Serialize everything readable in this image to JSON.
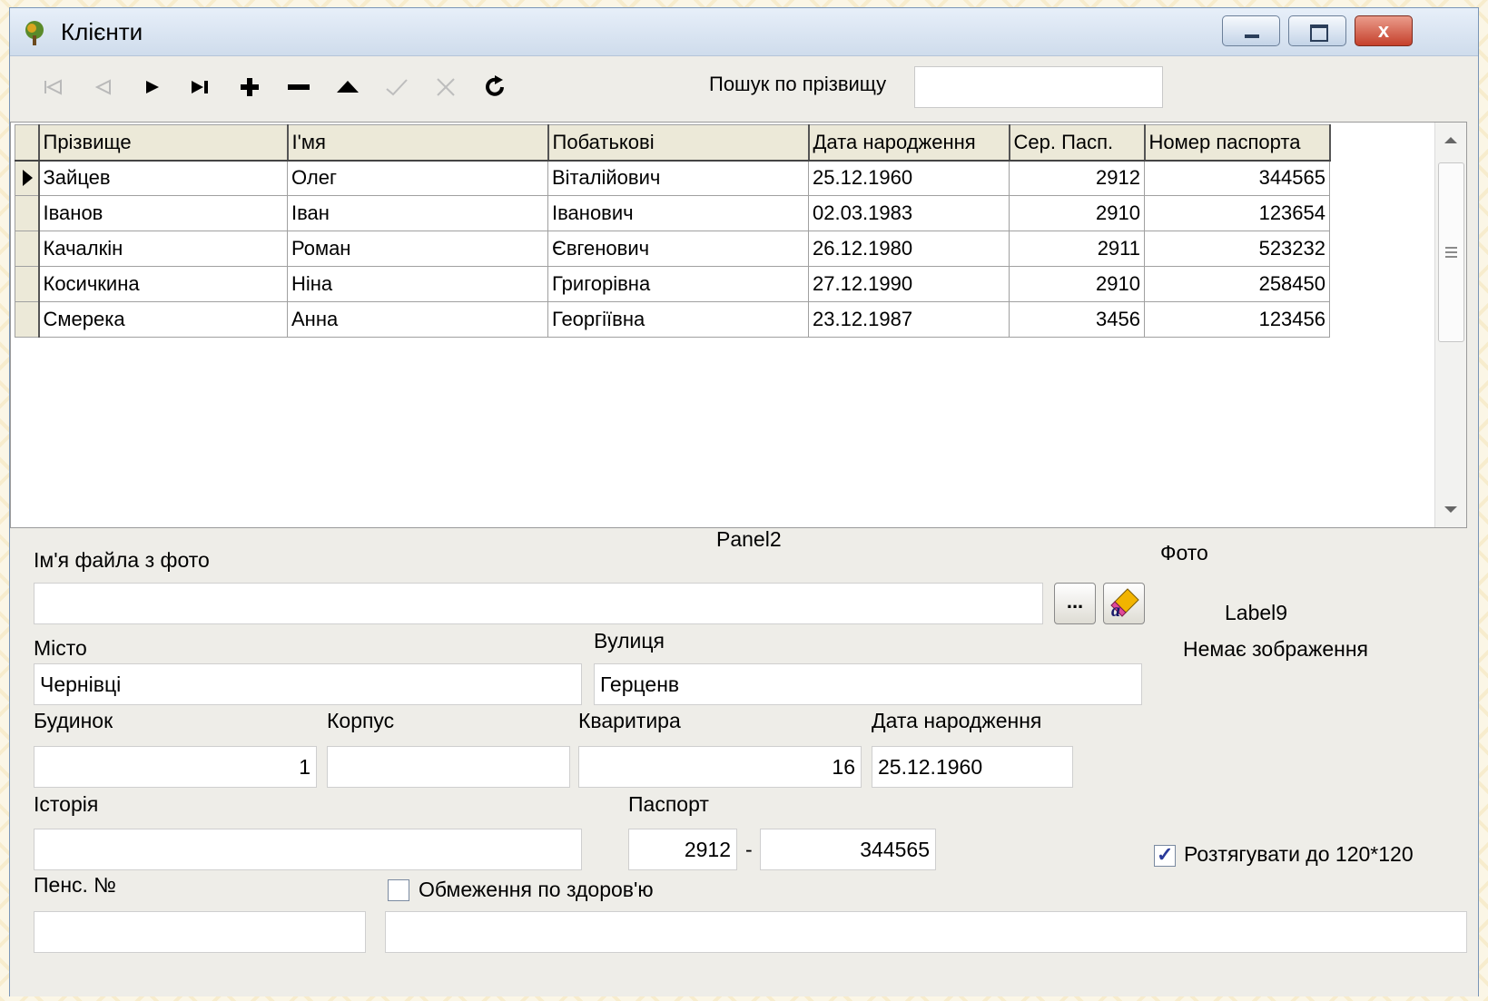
{
  "window": {
    "title": "Клієнти",
    "buttons": {
      "minimize": "minimize",
      "maximize": "maximize",
      "close": "x"
    }
  },
  "toolbar": {
    "nav_icons": [
      "first-icon",
      "prior-icon",
      "next-icon",
      "last-icon",
      "insert-icon",
      "delete-icon",
      "edit-icon",
      "post-icon",
      "cancel-icon",
      "refresh-icon"
    ],
    "search_label": "Пошук по прізвищу",
    "search_value": ""
  },
  "grid": {
    "columns": [
      "Прізвище",
      "І'мя",
      "Побатькові",
      "Дата народження",
      "Сер. Пасп.",
      "Номер паспорта"
    ],
    "rows": [
      [
        "Зайцев",
        "Олег",
        "Віталійович",
        "25.12.1960",
        "2912",
        "344565"
      ],
      [
        "Іванов",
        "Іван",
        "Іванович",
        "02.03.1983",
        "2910",
        "123654"
      ],
      [
        "Качалкін",
        "Роман",
        "Євгенович",
        "26.12.1980",
        "2911",
        "523232"
      ],
      [
        "Косичкина",
        "Ніна",
        "Григорівна",
        "27.12.1990",
        "2910",
        "258450"
      ],
      [
        "Смерека",
        "Анна",
        "Георгіївна",
        "23.12.1987",
        "3456",
        "123456"
      ]
    ],
    "selected_row": 0
  },
  "panel": {
    "caption": "Panel2",
    "photo_file_label": "Ім'я файла з фото",
    "photo_file_value": "",
    "browse_label": "...",
    "photo_label": "Фото",
    "label9": "Label9",
    "no_image": "Немає зображення",
    "city_label": "Місто",
    "city_value": "Чернівці",
    "street_label": "Вулиця",
    "street_value": "Герценв",
    "house_label": "Будинок",
    "house_value": "1",
    "block_label": "Корпус",
    "block_value": "",
    "apartment_label": "Кваритира",
    "apartment_value": "16",
    "birth_label": "Дата народження",
    "birth_value": "25.12.1960",
    "history_label": "Історія",
    "history_value": "",
    "passport_label": "Паспорт",
    "passport_series": "2912",
    "passport_sep": "-",
    "passport_number": "344565",
    "stretch_label": "Розтягувати  до 120*120",
    "stretch_checked": true,
    "pension_label": "Пенс. №",
    "pension_value": "",
    "health_label": "Обмеження по здоров'ю",
    "health_checked": false,
    "health_value": ""
  }
}
